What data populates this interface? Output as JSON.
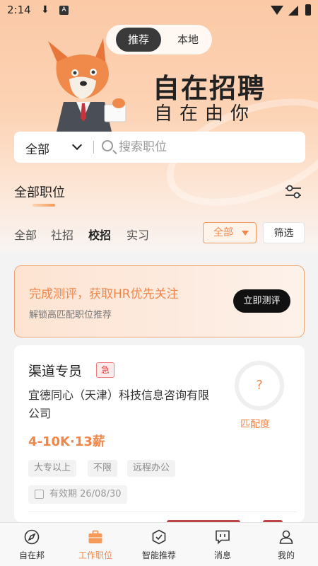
{
  "status_bar": {
    "time": "2:14",
    "badge": "A"
  },
  "header": {
    "toggle": {
      "active": "推荐",
      "inactive": "本地"
    },
    "slogan_main": "自在招聘",
    "slogan_sub": "自在由你"
  },
  "search": {
    "category": "全部",
    "placeholder": "搜索职位"
  },
  "section": {
    "title": "全部职位"
  },
  "tabs": [
    "全部",
    "社招",
    "校招",
    "实习"
  ],
  "selected_tab": "校招",
  "filters": {
    "dropdown_value": "全部",
    "filter_button": "筛选"
  },
  "promo": {
    "headline": "完成测评，获取HR优先关注",
    "subline": "解锁高匹配职位推荐",
    "button": "立即测评"
  },
  "job": {
    "title": "渠道专员",
    "urgent_badge": "急",
    "company": "宜德同心（天津）科技信息咨询有限公司",
    "salary": "4-10K·13薪",
    "tags": [
      "大专以上",
      "不限",
      "远程办公"
    ],
    "valid_until": "有效期 26/08/30",
    "match_value": "?",
    "match_label": "匹配度"
  },
  "nav": {
    "items": [
      {
        "label": "自在邦",
        "icon": "compass-icon"
      },
      {
        "label": "工作职位",
        "icon": "briefcase-icon"
      },
      {
        "label": "智能推荐",
        "icon": "smart-recommend-icon"
      },
      {
        "label": "消息",
        "icon": "message-icon"
      },
      {
        "label": "我的",
        "icon": "profile-icon"
      }
    ],
    "active_index": 1
  },
  "colors": {
    "accent": "#f0874a",
    "urgent": "#e54545",
    "dark_button": "#111111"
  }
}
